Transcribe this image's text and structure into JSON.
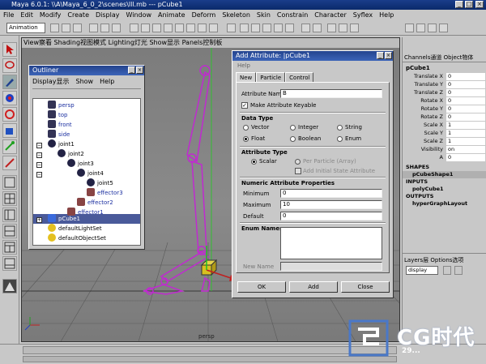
{
  "window": {
    "title": "Maya 6.0.1: \\\\A\\Maya_6_0_2\\scenes\\lll.mb  ---  pCube1",
    "min": "_",
    "max": "□",
    "close": "×"
  },
  "menubar": [
    "File",
    "Edit",
    "Modify",
    "Create",
    "Display",
    "Window",
    "Animate",
    "Deform",
    "Skeleton",
    "Skin",
    "Constrain",
    "Character",
    "Syflex",
    "Help"
  ],
  "toolbar": {
    "mode": "Animation"
  },
  "viewport": {
    "menu": "View察看  Shading视图模式  Lighting灯光  Show显示  Panels控制板",
    "camera_label": "persp"
  },
  "outliner": {
    "title": "Outliner",
    "menu": [
      "Display显示",
      "Show",
      "Help"
    ],
    "items": [
      "persp",
      "top",
      "front",
      "side",
      "joint1",
      "joint2",
      "joint3",
      "joint4",
      "joint5",
      "effector3",
      "effector2",
      "effector1",
      "pCube1",
      "defaultLightSet",
      "defaultObjectSet"
    ]
  },
  "dialog": {
    "title": "Add Attribute: |pCube1",
    "menu_help": "Help",
    "tabs": [
      "New",
      "Particle",
      "Control"
    ],
    "attr_name_label": "Attribute Name",
    "attr_name_value": "B",
    "keyable_label": "Make Attribute Keyable",
    "data_type_title": "Data Type",
    "data_types": [
      "Vector",
      "Integer",
      "String",
      "Float",
      "Boolean",
      "Enum"
    ],
    "attr_type_title": "Attribute Type",
    "attr_types": [
      "Scalar",
      "Per Particle (Array)",
      "Add Initial State Attribute"
    ],
    "numeric_title": "Numeric Attribute Properties",
    "minimum_label": "Minimum",
    "minimum_value": "0",
    "maximum_label": "Maximum",
    "maximum_value": "10",
    "default_label": "Default",
    "default_value": "0",
    "enum_title": "Enum Names",
    "new_name_label": "New Name",
    "buttons": [
      "OK",
      "Add",
      "Close"
    ]
  },
  "channelbox": {
    "tabs": "Channels通道  Object物体",
    "object": "pCube1",
    "channels": [
      {
        "name": "Translate X",
        "value": "0"
      },
      {
        "name": "Translate Y",
        "value": "0"
      },
      {
        "name": "Translate Z",
        "value": "0"
      },
      {
        "name": "Rotate X",
        "value": "0"
      },
      {
        "name": "Rotate Y",
        "value": "0"
      },
      {
        "name": "Rotate Z",
        "value": "0"
      },
      {
        "name": "Scale X",
        "value": "1"
      },
      {
        "name": "Scale Y",
        "value": "1"
      },
      {
        "name": "Scale Z",
        "value": "1"
      },
      {
        "name": "Visibility",
        "value": "on"
      },
      {
        "name": "A",
        "value": "0"
      }
    ],
    "shapes_label": "SHAPES",
    "shape": "pCubeShape1",
    "inputs_label": "INPUTS",
    "input": "polyCube1",
    "outputs_label": "OUTPUTS",
    "output": "hyperGraphLayout"
  },
  "layers": {
    "tabs": "Layers层  Options选项",
    "mode": "display"
  },
  "watermark": {
    "text": "CG时代",
    "sub": "29..."
  },
  "colors": {
    "title_blue": "#1a3d8a",
    "outliner_select": "#4a5a9a",
    "skeleton": "#c02ad0"
  }
}
